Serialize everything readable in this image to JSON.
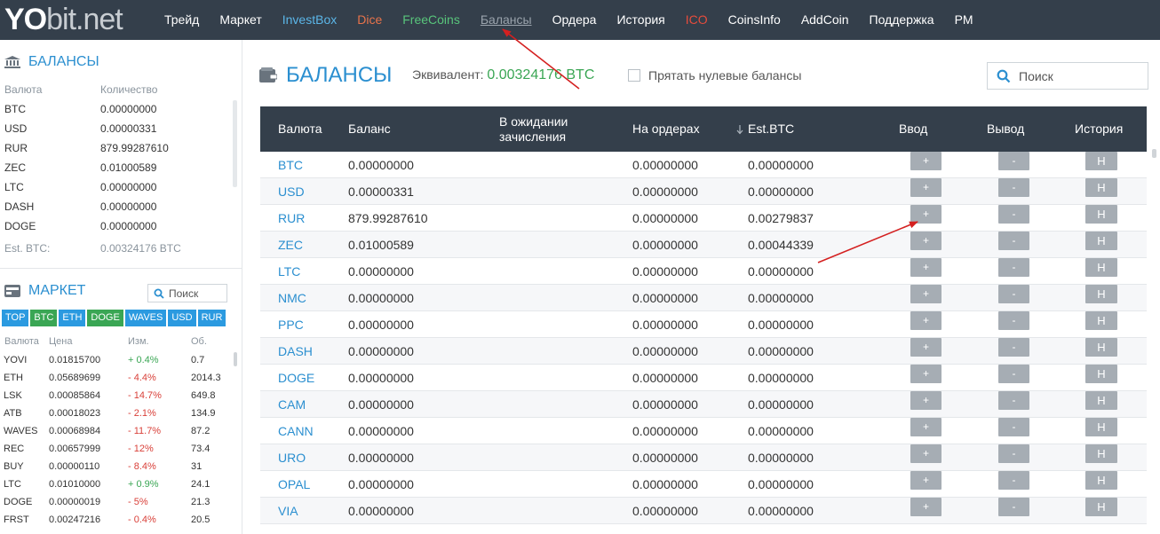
{
  "logo": {
    "yo": "YO",
    "rest": "bit.net"
  },
  "nav": [
    {
      "label": "Трейд",
      "style": "white"
    },
    {
      "label": "Маркет",
      "style": "white"
    },
    {
      "label": "InvestBox",
      "style": "blue"
    },
    {
      "label": "Dice",
      "style": "orange"
    },
    {
      "label": "FreeCoins",
      "style": "green"
    },
    {
      "label": "Балансы",
      "style": "active"
    },
    {
      "label": "Ордера",
      "style": "white"
    },
    {
      "label": "История",
      "style": "white"
    },
    {
      "label": "ICO",
      "style": "red"
    },
    {
      "label": "CoinsInfo",
      "style": "white"
    },
    {
      "label": "AddCoin",
      "style": "white"
    },
    {
      "label": "Поддержка",
      "style": "white"
    },
    {
      "label": "PM",
      "style": "white"
    }
  ],
  "sidebar": {
    "balances_title": "БАЛАНСЫ",
    "col_currency": "Валюта",
    "col_amount": "Количество",
    "balances": [
      {
        "currency": "BTC",
        "amount": "0.00000000"
      },
      {
        "currency": "USD",
        "amount": "0.00000331"
      },
      {
        "currency": "RUR",
        "amount": "879.99287610"
      },
      {
        "currency": "ZEC",
        "amount": "0.01000589"
      },
      {
        "currency": "LTC",
        "amount": "0.00000000"
      },
      {
        "currency": "DASH",
        "amount": "0.00000000"
      },
      {
        "currency": "DOGE",
        "amount": "0.00000000"
      }
    ],
    "est_label": "Est. BTC:",
    "est_value": "0.00324176 BTC",
    "market_title": "МАРКЕТ",
    "market_search": "Поиск",
    "market_tabs": [
      {
        "label": "TOP",
        "active": false
      },
      {
        "label": "BTC",
        "active": true
      },
      {
        "label": "ETH",
        "active": false
      },
      {
        "label": "DOGE",
        "active": true
      },
      {
        "label": "WAVES",
        "active": false
      },
      {
        "label": "USD",
        "active": false
      },
      {
        "label": "RUR",
        "active": false
      }
    ],
    "market_cols": {
      "currency": "Валюта",
      "price": "Цена",
      "change": "Изм.",
      "volume": "Об."
    },
    "market_rows": [
      {
        "currency": "YOVI",
        "price": "0.01815700",
        "change": "+ 0.4%",
        "dir": "pos",
        "volume": "0.7"
      },
      {
        "currency": "ETH",
        "price": "0.05689699",
        "change": "- 4.4%",
        "dir": "neg",
        "volume": "2014.3"
      },
      {
        "currency": "LSK",
        "price": "0.00085864",
        "change": "- 14.7%",
        "dir": "neg",
        "volume": "649.8"
      },
      {
        "currency": "ATB",
        "price": "0.00018023",
        "change": "- 2.1%",
        "dir": "neg",
        "volume": "134.9"
      },
      {
        "currency": "WAVES",
        "price": "0.00068984",
        "change": "- 11.7%",
        "dir": "neg",
        "volume": "87.2"
      },
      {
        "currency": "REC",
        "price": "0.00657999",
        "change": "- 12%",
        "dir": "neg",
        "volume": "73.4"
      },
      {
        "currency": "BUY",
        "price": "0.00000110",
        "change": "- 8.4%",
        "dir": "neg",
        "volume": "31"
      },
      {
        "currency": "LTC",
        "price": "0.01010000",
        "change": "+ 0.9%",
        "dir": "pos",
        "volume": "24.1"
      },
      {
        "currency": "DOGE",
        "price": "0.00000019",
        "change": "- 5%",
        "dir": "neg",
        "volume": "21.3"
      },
      {
        "currency": "FRST",
        "price": "0.00247216",
        "change": "- 0.4%",
        "dir": "neg",
        "volume": "20.5"
      }
    ]
  },
  "main": {
    "title": "БАЛАНСЫ",
    "equiv_label": "Эквивалент:",
    "equiv_value": "0.00324176 BTC",
    "hide_zero_label": "Прятать нулевые балансы",
    "search_placeholder": "Поиск",
    "columns": {
      "currency": "Валюта",
      "balance": "Баланс",
      "pending_1": "В ожидании",
      "pending_2": "зачисления",
      "orders": "На ордерах",
      "est_btc": "Est.BTC",
      "deposit": "Ввод",
      "withdraw": "Вывод",
      "history": "История"
    },
    "buttons": {
      "deposit": "+",
      "withdraw": "-",
      "history": "H"
    },
    "rows": [
      {
        "currency": "BTC",
        "balance": "0.00000000",
        "orders": "0.00000000",
        "est": "0.00000000"
      },
      {
        "currency": "USD",
        "balance": "0.00000331",
        "orders": "0.00000000",
        "est": "0.00000000"
      },
      {
        "currency": "RUR",
        "balance": "879.99287610",
        "orders": "0.00000000",
        "est": "0.00279837"
      },
      {
        "currency": "ZEC",
        "balance": "0.01000589",
        "orders": "0.00000000",
        "est": "0.00044339"
      },
      {
        "currency": "LTC",
        "balance": "0.00000000",
        "orders": "0.00000000",
        "est": "0.00000000"
      },
      {
        "currency": "NMC",
        "balance": "0.00000000",
        "orders": "0.00000000",
        "est": "0.00000000"
      },
      {
        "currency": "PPC",
        "balance": "0.00000000",
        "orders": "0.00000000",
        "est": "0.00000000"
      },
      {
        "currency": "DASH",
        "balance": "0.00000000",
        "orders": "0.00000000",
        "est": "0.00000000"
      },
      {
        "currency": "DOGE",
        "balance": "0.00000000",
        "orders": "0.00000000",
        "est": "0.00000000"
      },
      {
        "currency": "CAM",
        "balance": "0.00000000",
        "orders": "0.00000000",
        "est": "0.00000000"
      },
      {
        "currency": "CANN",
        "balance": "0.00000000",
        "orders": "0.00000000",
        "est": "0.00000000"
      },
      {
        "currency": "URO",
        "balance": "0.00000000",
        "orders": "0.00000000",
        "est": "0.00000000"
      },
      {
        "currency": "OPAL",
        "balance": "0.00000000",
        "orders": "0.00000000",
        "est": "0.00000000"
      },
      {
        "currency": "VIA",
        "balance": "0.00000000",
        "orders": "0.00000000",
        "est": "0.00000000"
      }
    ]
  },
  "colors": {
    "topbar": "#343f4b",
    "accent_blue": "#2b8fd0",
    "positive": "#3aa654",
    "negative": "#d9413a",
    "button_gray": "#a6adb4",
    "annotation_red": "#d42020"
  },
  "icons": [
    "bank-icon",
    "market-icon",
    "wallet-icon",
    "search-icon",
    "sort-down-icon"
  ]
}
